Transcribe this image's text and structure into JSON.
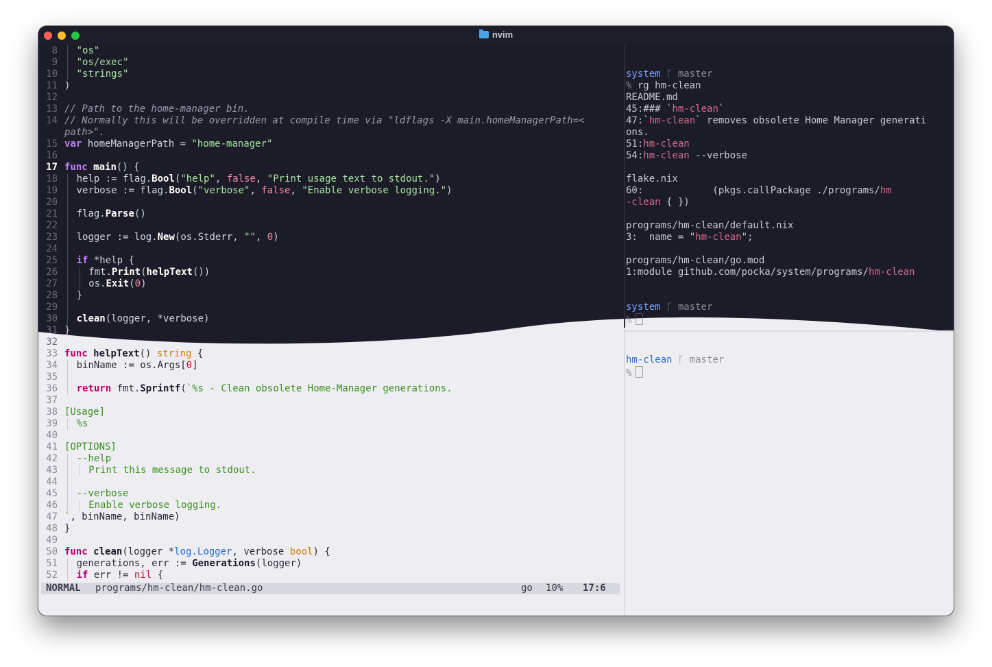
{
  "window": {
    "title": "nvim",
    "lights": {
      "close": "#ff5f57",
      "minimize": "#febc2e",
      "zoom": "#28c840"
    }
  },
  "colors": {
    "dark_bg": "#1c1c28",
    "light_bg": "#eeeef2",
    "keyword": "#c084fc",
    "string": "#a6e3a1",
    "accent_red": "#c65a78",
    "prompt_blue": "#7aa2f7"
  },
  "editor": {
    "cursor_line": 17,
    "lines": [
      {
        "n": "8",
        "segs": [
          [
            "\"os\"",
            "s"
          ]
        ],
        "indent": 1
      },
      {
        "n": "9",
        "segs": [
          [
            "\"os/exec\"",
            "s"
          ]
        ],
        "indent": 1
      },
      {
        "n": "10",
        "segs": [
          [
            "\"strings\"",
            "s"
          ]
        ],
        "indent": 1
      },
      {
        "n": "11",
        "segs": [
          [
            ")",
            "p"
          ]
        ],
        "indent": 0
      },
      {
        "n": "12",
        "segs": [],
        "indent": 0
      },
      {
        "n": "13",
        "segs": [
          [
            "// Path to the home-manager bin.",
            "c"
          ]
        ],
        "indent": 0
      },
      {
        "n": "14",
        "segs": [
          [
            "// Normally this will be overridden at compile time via \"ldflags -X main.homeManagerPath=<",
            "c"
          ]
        ],
        "indent": 0
      },
      {
        "n": "",
        "segs": [
          [
            "path>\".",
            "c"
          ]
        ],
        "indent": 0
      },
      {
        "n": "15",
        "segs": [
          [
            "var",
            "k"
          ],
          [
            " homeManagerPath = ",
            "p"
          ],
          [
            "\"home-manager\"",
            "s"
          ]
        ],
        "indent": 0
      },
      {
        "n": "16",
        "segs": [],
        "indent": 0
      },
      {
        "n": "17",
        "segs": [
          [
            "func",
            "k"
          ],
          [
            " ",
            "p"
          ],
          [
            "main",
            "f"
          ],
          [
            "() {",
            "p"
          ]
        ],
        "indent": 0
      },
      {
        "n": "18",
        "segs": [
          [
            "help := flag.",
            "p"
          ],
          [
            "Bool",
            "f"
          ],
          [
            "(",
            "p"
          ],
          [
            "\"help\"",
            "s"
          ],
          [
            ", ",
            "p"
          ],
          [
            "false",
            "b"
          ],
          [
            ", ",
            "p"
          ],
          [
            "\"Print usage text to stdout.\"",
            "s"
          ],
          [
            ")",
            "p"
          ]
        ],
        "indent": 1
      },
      {
        "n": "19",
        "segs": [
          [
            "verbose := flag.",
            "p"
          ],
          [
            "Bool",
            "f"
          ],
          [
            "(",
            "p"
          ],
          [
            "\"verbose\"",
            "s"
          ],
          [
            ", ",
            "p"
          ],
          [
            "false",
            "b"
          ],
          [
            ", ",
            "p"
          ],
          [
            "\"Enable verbose logging.\"",
            "s"
          ],
          [
            ")",
            "p"
          ]
        ],
        "indent": 1
      },
      {
        "n": "20",
        "segs": [],
        "indent": 1
      },
      {
        "n": "21",
        "segs": [
          [
            "flag.",
            "p"
          ],
          [
            "Parse",
            "f"
          ],
          [
            "()",
            "p"
          ]
        ],
        "indent": 1
      },
      {
        "n": "22",
        "segs": [],
        "indent": 1
      },
      {
        "n": "23",
        "segs": [
          [
            "logger := log.",
            "p"
          ],
          [
            "New",
            "f"
          ],
          [
            "(os.Stderr, ",
            "p"
          ],
          [
            "\"\"",
            "s"
          ],
          [
            ", ",
            "p"
          ],
          [
            "0",
            "b"
          ],
          [
            ")",
            "p"
          ]
        ],
        "indent": 1
      },
      {
        "n": "24",
        "segs": [],
        "indent": 1
      },
      {
        "n": "25",
        "segs": [
          [
            "if",
            "k"
          ],
          [
            " *help {",
            "p"
          ]
        ],
        "indent": 1
      },
      {
        "n": "26",
        "segs": [
          [
            "fmt.",
            "p"
          ],
          [
            "Print",
            "f"
          ],
          [
            "(",
            "p"
          ],
          [
            "helpText",
            "f"
          ],
          [
            "())",
            "p"
          ]
        ],
        "indent": 2
      },
      {
        "n": "27",
        "segs": [
          [
            "os.",
            "p"
          ],
          [
            "Exit",
            "f"
          ],
          [
            "(",
            "p"
          ],
          [
            "0",
            "b"
          ],
          [
            ")",
            "p"
          ]
        ],
        "indent": 2
      },
      {
        "n": "28",
        "segs": [
          [
            "}",
            "p"
          ]
        ],
        "indent": 1
      },
      {
        "n": "29",
        "segs": [],
        "indent": 1
      },
      {
        "n": "30",
        "segs": [
          [
            "clean",
            "f"
          ],
          [
            "(logger, *verbose)",
            "p"
          ]
        ],
        "indent": 1
      },
      {
        "n": "31",
        "segs": [
          [
            "}",
            "p"
          ]
        ],
        "indent": 0
      },
      {
        "n": "32",
        "segs": [],
        "indent": 0
      },
      {
        "n": "33",
        "segs": [
          [
            "func",
            "k"
          ],
          [
            " ",
            "p"
          ],
          [
            "helpText",
            "f"
          ],
          [
            "() ",
            "p"
          ],
          [
            "string",
            "t"
          ],
          [
            " {",
            "p"
          ]
        ],
        "indent": 0
      },
      {
        "n": "34",
        "segs": [
          [
            "binName := os.Args[",
            "p"
          ],
          [
            "0",
            "b"
          ],
          [
            "]",
            "p"
          ]
        ],
        "indent": 1
      },
      {
        "n": "35",
        "segs": [],
        "indent": 1
      },
      {
        "n": "36",
        "segs": [
          [
            "return",
            "k"
          ],
          [
            " fmt.",
            "p"
          ],
          [
            "Sprintf",
            "f"
          ],
          [
            "(",
            "p"
          ],
          [
            "`%s - Clean obsolete Home-Manager generations.",
            "s"
          ]
        ],
        "indent": 1
      },
      {
        "n": "37",
        "segs": [],
        "indent": 0
      },
      {
        "n": "38",
        "segs": [
          [
            "[Usage]",
            "s"
          ]
        ],
        "indent": 0
      },
      {
        "n": "39",
        "segs": [
          [
            "%s",
            "s"
          ]
        ],
        "indent": 1
      },
      {
        "n": "40",
        "segs": [],
        "indent": 0
      },
      {
        "n": "41",
        "segs": [
          [
            "[OPTIONS]",
            "s"
          ]
        ],
        "indent": 0
      },
      {
        "n": "42",
        "segs": [
          [
            "--help",
            "s"
          ]
        ],
        "indent": 1
      },
      {
        "n": "43",
        "segs": [
          [
            "Print this message to stdout.",
            "s"
          ]
        ],
        "indent": 2
      },
      {
        "n": "44",
        "segs": [],
        "indent": 1
      },
      {
        "n": "45",
        "segs": [
          [
            "--verbose",
            "s"
          ]
        ],
        "indent": 1
      },
      {
        "n": "46",
        "segs": [
          [
            "Enable verbose logging.",
            "s"
          ]
        ],
        "indent": 2
      },
      {
        "n": "47",
        "segs": [
          [
            "`",
            "s"
          ],
          [
            ", binName, binName)",
            "p"
          ]
        ],
        "indent": 0
      },
      {
        "n": "48",
        "segs": [
          [
            "}",
            "p"
          ]
        ],
        "indent": 0
      },
      {
        "n": "49",
        "segs": [],
        "indent": 0
      },
      {
        "n": "50",
        "segs": [
          [
            "func",
            "k"
          ],
          [
            " ",
            "p"
          ],
          [
            "clean",
            "f"
          ],
          [
            "(logger *",
            "p"
          ],
          [
            "log.Logger",
            "t2"
          ],
          [
            ", verbose ",
            "p"
          ],
          [
            "bool",
            "t"
          ],
          [
            ") {",
            "p"
          ]
        ],
        "indent": 0
      },
      {
        "n": "51",
        "segs": [
          [
            "generations, err := ",
            "p"
          ],
          [
            "Generations",
            "f"
          ],
          [
            "(logger)",
            "p"
          ]
        ],
        "indent": 1
      },
      {
        "n": "52",
        "segs": [
          [
            "if",
            "k"
          ],
          [
            " err != ",
            "p"
          ],
          [
            "nil",
            "b"
          ],
          [
            " {",
            "p"
          ]
        ],
        "indent": 1
      }
    ]
  },
  "statusline": {
    "mode": "NORMAL",
    "file": "programs/hm-clean/hm-clean.go",
    "filetype": "go",
    "percent": "10%",
    "position": "17:6"
  },
  "terminal_top": {
    "lines": [
      {
        "segs": []
      },
      {
        "segs": []
      },
      {
        "segs": [
          [
            "system",
            "pb"
          ],
          [
            " ᚴ master",
            "g"
          ]
        ]
      },
      {
        "segs": [
          [
            "% ",
            "g"
          ],
          [
            "rg hm-clean",
            "p"
          ]
        ]
      },
      {
        "segs": [
          [
            "README.md",
            "p"
          ]
        ]
      },
      {
        "segs": [
          [
            "45:### `",
            "p"
          ],
          [
            "hm-clean",
            "r"
          ],
          [
            "`",
            "p"
          ]
        ]
      },
      {
        "segs": [
          [
            "47:`",
            "p"
          ],
          [
            "hm-clean",
            "r"
          ],
          [
            "` removes obsolete Home Manager generati",
            "p"
          ]
        ]
      },
      {
        "segs": [
          [
            "ons.",
            "p"
          ]
        ]
      },
      {
        "segs": [
          [
            "51:",
            "p"
          ],
          [
            "hm-clean",
            "r"
          ]
        ]
      },
      {
        "segs": [
          [
            "54:",
            "p"
          ],
          [
            "hm-clean",
            "r"
          ],
          [
            " --verbose",
            "p"
          ]
        ]
      },
      {
        "segs": []
      },
      {
        "segs": [
          [
            "flake.nix",
            "p"
          ]
        ]
      },
      {
        "segs": [
          [
            "60:            (pkgs.callPackage ./programs/",
            "p"
          ],
          [
            "hm",
            "r"
          ]
        ]
      },
      {
        "segs": [
          [
            "-clean",
            "r"
          ],
          [
            " { })",
            "p"
          ]
        ]
      },
      {
        "segs": []
      },
      {
        "segs": [
          [
            "programs/hm-clean/default.nix",
            "p"
          ]
        ]
      },
      {
        "segs": [
          [
            "3:  name = \"",
            "p"
          ],
          [
            "hm-clean",
            "r"
          ],
          [
            "\";",
            "p"
          ]
        ]
      },
      {
        "segs": []
      },
      {
        "segs": [
          [
            "programs/hm-clean/go.mod",
            "p"
          ]
        ]
      },
      {
        "segs": [
          [
            "1:module github.com/pocka/system/programs/",
            "p"
          ],
          [
            "hm-clean",
            "r"
          ]
        ]
      },
      {
        "segs": []
      },
      {
        "segs": []
      },
      {
        "segs": [
          [
            "system",
            "pb"
          ],
          [
            " ᚴ master",
            "g"
          ]
        ]
      },
      {
        "segs": [
          [
            "%",
            "g"
          ]
        ],
        "cursor": true
      }
    ]
  },
  "terminal_bottom": {
    "lines": [
      {
        "segs": [
          [
            "hm-clean",
            "pb"
          ],
          [
            " ᚴ master",
            "g"
          ]
        ]
      },
      {
        "segs": [
          [
            "%",
            "g"
          ]
        ],
        "cursor": true
      }
    ]
  }
}
